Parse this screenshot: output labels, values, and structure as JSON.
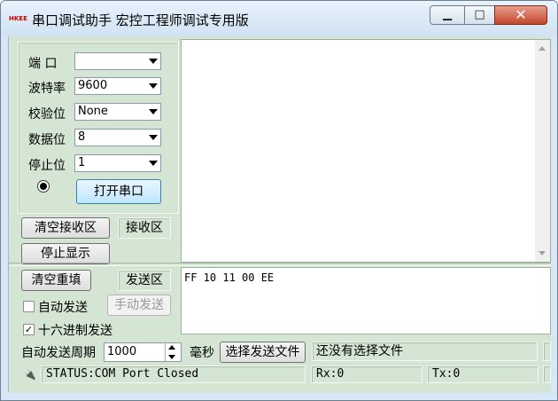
{
  "window": {
    "title": "串口调试助手  宏控工程师调试专用版",
    "icon_text": "HKEE",
    "controls": {
      "minimize": "▁",
      "maximize": "□",
      "close": "✕"
    }
  },
  "serial": {
    "port_label": "端  口",
    "port_value": "",
    "baud_label": "波特率",
    "baud_value": "9600",
    "parity_label": "校验位",
    "parity_value": "None",
    "databits_label": "数据位",
    "databits_value": "8",
    "stopbits_label": "停止位",
    "stopbits_value": "1",
    "open_button": "打开串口"
  },
  "receive": {
    "clear_button": "清空接收区",
    "area_label": "接收区",
    "stop_display_button": "停止显示",
    "content": ""
  },
  "send": {
    "clear_button": "清空重填",
    "area_label": "发送区",
    "auto_send_label": "自动发送",
    "auto_send_checked": false,
    "manual_send_button": "手动发送",
    "hex_send_label": "十六进制发送",
    "hex_send_checked": true,
    "content": "FF 10 11 00 EE",
    "period_label": "自动发送周期",
    "period_value": "1000",
    "period_unit": "毫秒",
    "select_file_button": "选择发送文件",
    "file_status": "还没有选择文件"
  },
  "statusbar": {
    "status": "STATUS:COM Port Closed",
    "rx": "Rx:0",
    "tx": "Tx:0"
  },
  "colors": {
    "panel_bg": "#d4e5d3",
    "frame_bg": "#d7e7f6",
    "button_hover": "#bee6fd"
  }
}
